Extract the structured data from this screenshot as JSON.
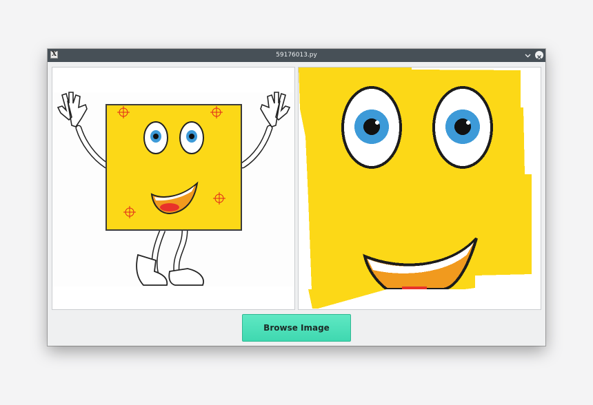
{
  "window": {
    "title": "59176013.py",
    "app_icon": "x11-app-icon",
    "controls": [
      "minimize-chevron-icon",
      "close-icon"
    ]
  },
  "panels": {
    "left": {
      "content": "original-cartoon-image",
      "markers": "red-crosshair-icon"
    },
    "right": {
      "content": "warped-cartoon-image"
    }
  },
  "browse": {
    "label": "Browse Image"
  },
  "colors": {
    "titlebar": "#475057",
    "button": "#4fe0b8",
    "cartoon_yellow": "#fcd817",
    "marker": "#e0241b"
  }
}
